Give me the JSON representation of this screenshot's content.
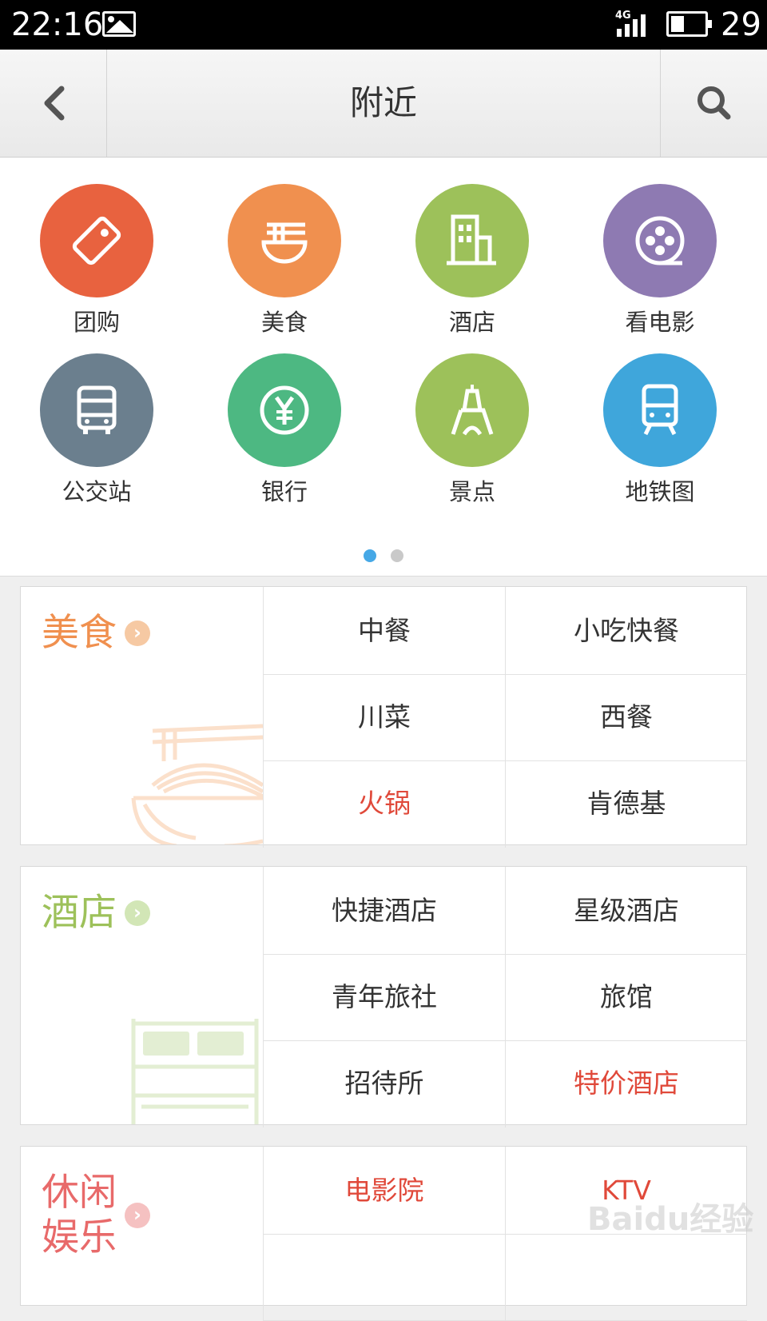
{
  "status_bar": {
    "time": "22:16",
    "network": "4G",
    "battery_level": "29"
  },
  "header": {
    "title": "附近",
    "back_icon": "chevron-left-icon",
    "search_icon": "search-icon"
  },
  "categories": [
    {
      "label": "团购",
      "icon": "tag-icon",
      "color": "#e8623f"
    },
    {
      "label": "美食",
      "icon": "noodle-bowl-icon",
      "color": "#f0904f"
    },
    {
      "label": "酒店",
      "icon": "building-icon",
      "color": "#9dc15a"
    },
    {
      "label": "看电影",
      "icon": "film-reel-icon",
      "color": "#8e7ab2"
    },
    {
      "label": "公交站",
      "icon": "bus-icon",
      "color": "#6b7f8e"
    },
    {
      "label": "银行",
      "icon": "yen-coin-icon",
      "color": "#4db882"
    },
    {
      "label": "景点",
      "icon": "tower-icon",
      "color": "#9dc15a"
    },
    {
      "label": "地铁图",
      "icon": "train-icon",
      "color": "#3fa6db"
    }
  ],
  "pager": {
    "pages": 2,
    "active": 0
  },
  "sections": [
    {
      "title": "美食",
      "color": "#f0904f",
      "items": [
        "中餐",
        "小吃快餐",
        "川菜",
        "西餐",
        "火锅",
        "肯德基"
      ],
      "highlighted": [
        "火锅"
      ]
    },
    {
      "title": "酒店",
      "color": "#9dc15a",
      "items": [
        "快捷酒店",
        "星级酒店",
        "青年旅社",
        "旅馆",
        "招待所",
        "特价酒店"
      ],
      "highlighted": [
        "特价酒店"
      ]
    },
    {
      "title": "休闲娱乐",
      "color": "#e86a6a",
      "items": [
        "电影院",
        "KTV"
      ],
      "highlighted": [
        "电影院",
        "KTV"
      ]
    }
  ],
  "watermark": "Baidu经验"
}
